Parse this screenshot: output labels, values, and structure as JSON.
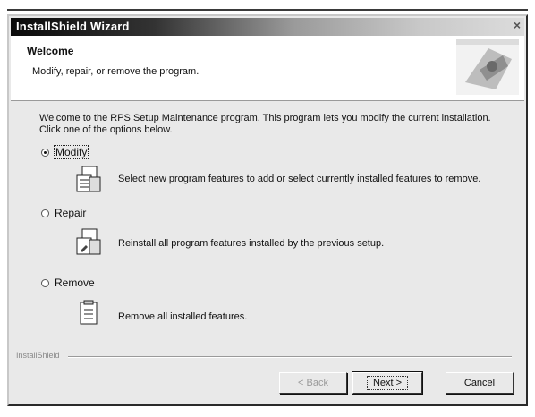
{
  "window": {
    "title": "InstallShield Wizard",
    "close_glyph": "×"
  },
  "header": {
    "title": "Welcome",
    "subtitle": "Modify, repair, or remove the program."
  },
  "intro_text": "Welcome to the RPS Setup Maintenance program. This program lets you modify the current installation. Click one of the options below.",
  "options": [
    {
      "id": "modify",
      "label": "Modify",
      "selected": true,
      "icon": "modify-features-icon",
      "description": "Select new program features to add or select currently installed features to remove."
    },
    {
      "id": "repair",
      "label": "Repair",
      "selected": false,
      "icon": "repair-install-icon",
      "description": "Reinstall all program features installed by the previous setup."
    },
    {
      "id": "remove",
      "label": "Remove",
      "selected": false,
      "icon": "remove-features-icon",
      "description": "Remove all installed features."
    }
  ],
  "footer": {
    "brand": "InstallShield"
  },
  "buttons": {
    "back": "< Back",
    "next": "Next >",
    "cancel": "Cancel"
  },
  "colors": {
    "dialog_bg": "#e9e9e9",
    "title_text": "#ffffff",
    "disabled_text": "#9a9a9a"
  }
}
